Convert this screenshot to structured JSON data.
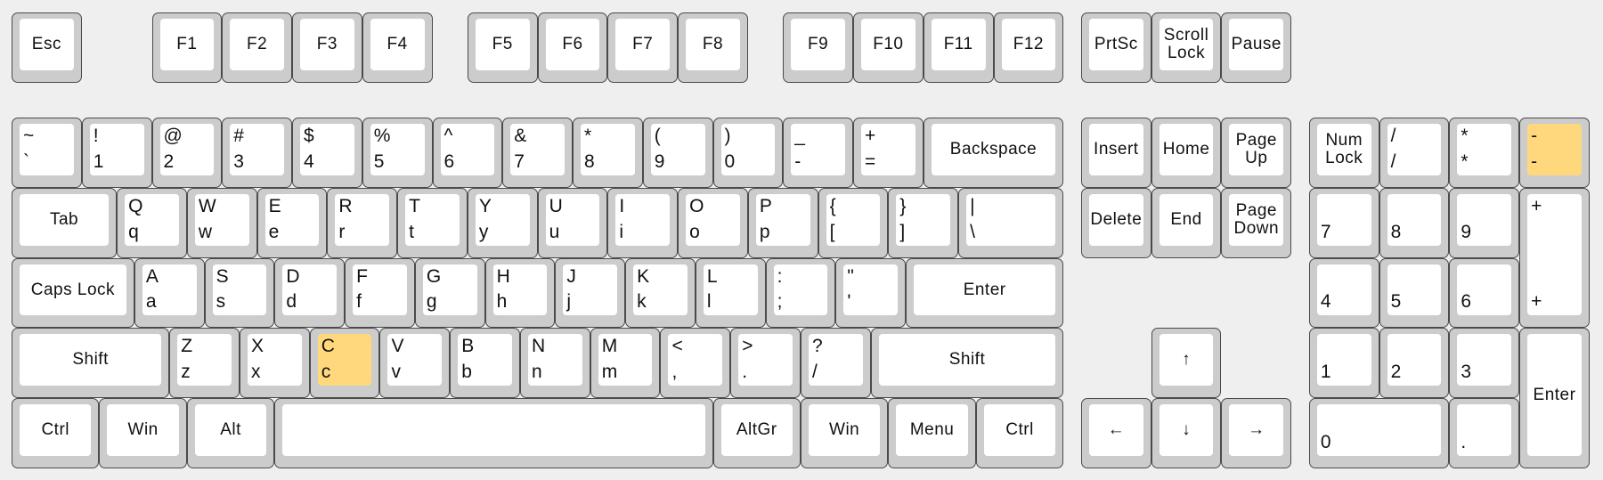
{
  "highlight_color": "#ffd87e",
  "keys": [
    {
      "label": "Esc"
    },
    {
      "label": "F1"
    },
    {
      "label": "F2"
    },
    {
      "label": "F3"
    },
    {
      "label": "F4"
    },
    {
      "label": "F5"
    },
    {
      "label": "F6"
    },
    {
      "label": "F7"
    },
    {
      "label": "F8"
    },
    {
      "label": "F9"
    },
    {
      "label": "F10"
    },
    {
      "label": "F11"
    },
    {
      "label": "F12"
    },
    {
      "label": "PrtSc"
    },
    {
      "label": "Scroll\nLock"
    },
    {
      "label": "Pause"
    },
    {
      "top": "~",
      "bottom": "`"
    },
    {
      "top": "!",
      "bottom": "1"
    },
    {
      "top": "@",
      "bottom": "2"
    },
    {
      "top": "#",
      "bottom": "3"
    },
    {
      "top": "$",
      "bottom": "4"
    },
    {
      "top": "%",
      "bottom": "5"
    },
    {
      "top": "^",
      "bottom": "6"
    },
    {
      "top": "&",
      "bottom": "7"
    },
    {
      "top": "*",
      "bottom": "8"
    },
    {
      "top": "(",
      "bottom": "9"
    },
    {
      "top": ")",
      "bottom": "0"
    },
    {
      "top": "_",
      "bottom": "-"
    },
    {
      "top": "+",
      "bottom": "="
    },
    {
      "label": "Backspace"
    },
    {
      "label": "Insert"
    },
    {
      "label": "Home"
    },
    {
      "label": "Page\nUp"
    },
    {
      "label": "Num\nLock"
    },
    {
      "top": "/",
      "bottom": "/"
    },
    {
      "top": "*",
      "bottom": "*"
    },
    {
      "top": "-",
      "bottom": "-",
      "highlighted": true
    },
    {
      "label": "Tab"
    },
    {
      "top": "Q",
      "bottom": "q"
    },
    {
      "top": "W",
      "bottom": "w"
    },
    {
      "top": "E",
      "bottom": "e"
    },
    {
      "top": "R",
      "bottom": "r"
    },
    {
      "top": "T",
      "bottom": "t"
    },
    {
      "top": "Y",
      "bottom": "y"
    },
    {
      "top": "U",
      "bottom": "u"
    },
    {
      "top": "I",
      "bottom": "i"
    },
    {
      "top": "O",
      "bottom": "o"
    },
    {
      "top": "P",
      "bottom": "p"
    },
    {
      "top": "{",
      "bottom": "["
    },
    {
      "top": "}",
      "bottom": "]"
    },
    {
      "top": "|",
      "bottom": "\\"
    },
    {
      "label": "Delete"
    },
    {
      "label": "End"
    },
    {
      "label": "Page\nDown"
    },
    {
      "bottom": "7"
    },
    {
      "bottom": "8"
    },
    {
      "bottom": "9"
    },
    {
      "top": "+",
      "bottom": "+"
    },
    {
      "label": "Caps Lock"
    },
    {
      "top": "A",
      "bottom": "a"
    },
    {
      "top": "S",
      "bottom": "s"
    },
    {
      "top": "D",
      "bottom": "d"
    },
    {
      "top": "F",
      "bottom": "f"
    },
    {
      "top": "G",
      "bottom": "g"
    },
    {
      "top": "H",
      "bottom": "h"
    },
    {
      "top": "J",
      "bottom": "j"
    },
    {
      "top": "K",
      "bottom": "k"
    },
    {
      "top": "L",
      "bottom": "l"
    },
    {
      "top": ":",
      "bottom": ";"
    },
    {
      "top": "\"",
      "bottom": "'"
    },
    {
      "label": "Enter"
    },
    {
      "bottom": "4"
    },
    {
      "bottom": "5"
    },
    {
      "bottom": "6"
    },
    {
      "label": "Shift"
    },
    {
      "top": "Z",
      "bottom": "z"
    },
    {
      "top": "X",
      "bottom": "x"
    },
    {
      "top": "C",
      "bottom": "c",
      "highlighted": true
    },
    {
      "top": "V",
      "bottom": "v"
    },
    {
      "top": "B",
      "bottom": "b"
    },
    {
      "top": "N",
      "bottom": "n"
    },
    {
      "top": "M",
      "bottom": "m"
    },
    {
      "top": "<",
      "bottom": ","
    },
    {
      "top": ">",
      "bottom": "."
    },
    {
      "top": "?",
      "bottom": "/"
    },
    {
      "label": "Shift"
    },
    {
      "label": "↑"
    },
    {
      "bottom": "1"
    },
    {
      "bottom": "2"
    },
    {
      "bottom": "3"
    },
    {
      "label": "Enter"
    },
    {
      "label": "Ctrl"
    },
    {
      "label": "Win"
    },
    {
      "label": "Alt"
    },
    {
      "label": ""
    },
    {
      "label": "AltGr"
    },
    {
      "label": "Win"
    },
    {
      "label": "Menu"
    },
    {
      "label": "Ctrl"
    },
    {
      "label": "←"
    },
    {
      "label": "↓"
    },
    {
      "label": "→"
    },
    {
      "bottom": "0"
    },
    {
      "bottom": "."
    }
  ]
}
